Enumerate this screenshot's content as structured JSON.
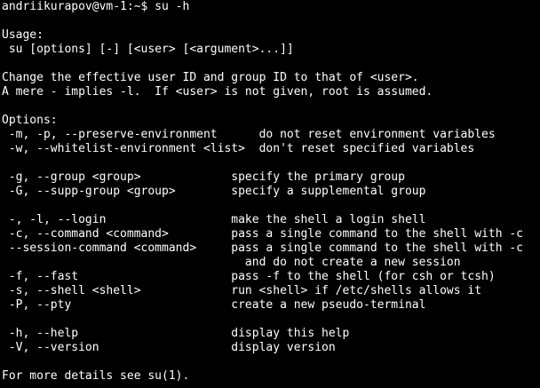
{
  "terminal": {
    "lines": [
      "andriikurapov@vm-1:~$ su -h",
      "",
      "Usage:",
      " su [options] [-] [<user> [<argument>...]]",
      "",
      "Change the effective user ID and group ID to that of <user>.",
      "A mere - implies -l.  If <user> is not given, root is assumed.",
      "",
      "Options:",
      " -m, -p, --preserve-environment      do not reset environment variables",
      " -w, --whitelist-environment <list>  don't reset specified variables",
      "",
      " -g, --group <group>             specify the primary group",
      " -G, --supp-group <group>        specify a supplemental group",
      "",
      " -, -l, --login                  make the shell a login shell",
      " -c, --command <command>         pass a single command to the shell with -c",
      " --session-command <command>     pass a single command to the shell with -c",
      "                                   and do not create a new session",
      " -f, --fast                      pass -f to the shell (for csh or tcsh)",
      " -s, --shell <shell>             run <shell> if /etc/shells allows it",
      " -P, --pty                       create a new pseudo-terminal",
      "",
      " -h, --help                      display this help",
      " -V, --version                   display version",
      "",
      "For more details see su(1)."
    ]
  }
}
